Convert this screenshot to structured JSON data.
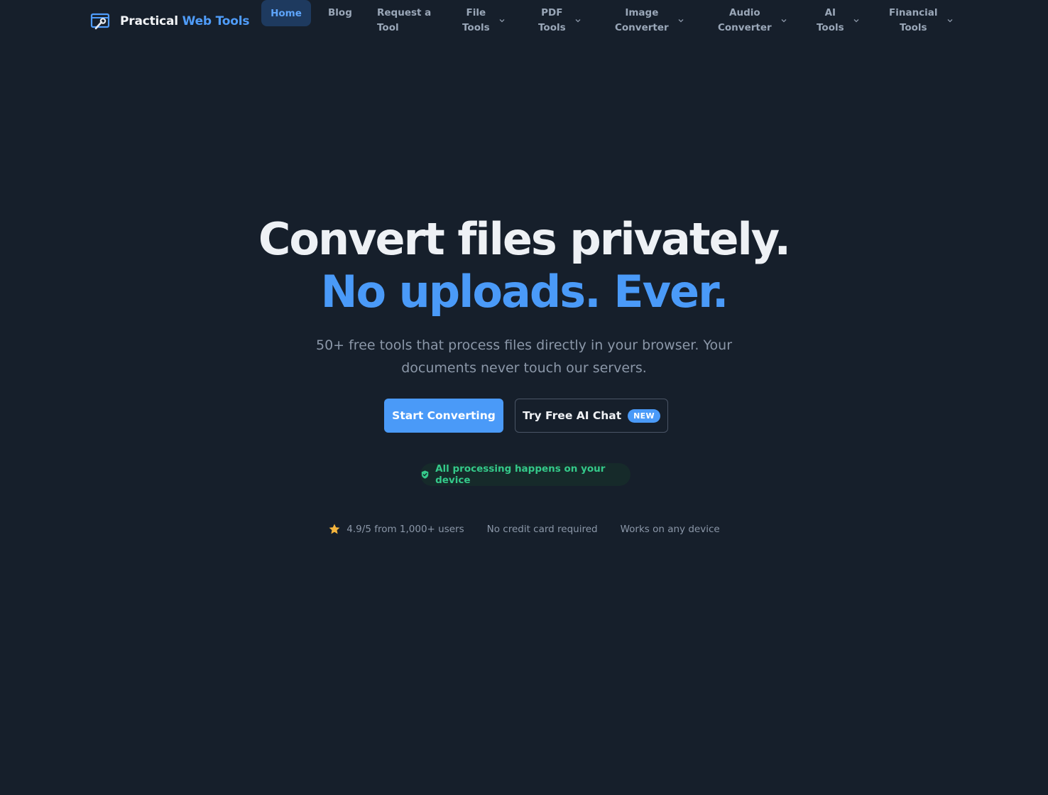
{
  "brand": {
    "name_part1": "Practical",
    "name_part2": "Web Tools",
    "icon": "wrench-window-icon"
  },
  "nav": {
    "home": "Home",
    "items": [
      {
        "label": "Blog",
        "dropdown": false
      },
      {
        "label": "Request a\nTool",
        "dropdown": false
      },
      {
        "label": "File\nTools",
        "dropdown": true
      },
      {
        "label": "PDF\nTools",
        "dropdown": true
      },
      {
        "label": "Image\nConverter",
        "dropdown": true
      },
      {
        "label": "Audio\nConverter",
        "dropdown": true
      },
      {
        "label": "AI\nTools",
        "dropdown": true
      },
      {
        "label": "Financial\nTools",
        "dropdown": true
      }
    ]
  },
  "hero": {
    "headline_line1": "Convert files privately.",
    "headline_line2": "No uploads. Ever.",
    "subtitle": "50+ free tools that process files directly in your browser. Your documents never touch our servers.",
    "primary_cta": "Start Converting",
    "secondary_cta": "Try Free AI Chat",
    "secondary_badge": "NEW",
    "privacy_note": "All processing happens on your device"
  },
  "trust": {
    "rating": "4.9/5 from 1,000+ users",
    "no_card": "No credit card required",
    "any_device": "Works on any device"
  },
  "colors": {
    "background": "#161f2b",
    "accent": "#4a9af8",
    "success": "#34c98a",
    "star": "#f5b53d"
  }
}
